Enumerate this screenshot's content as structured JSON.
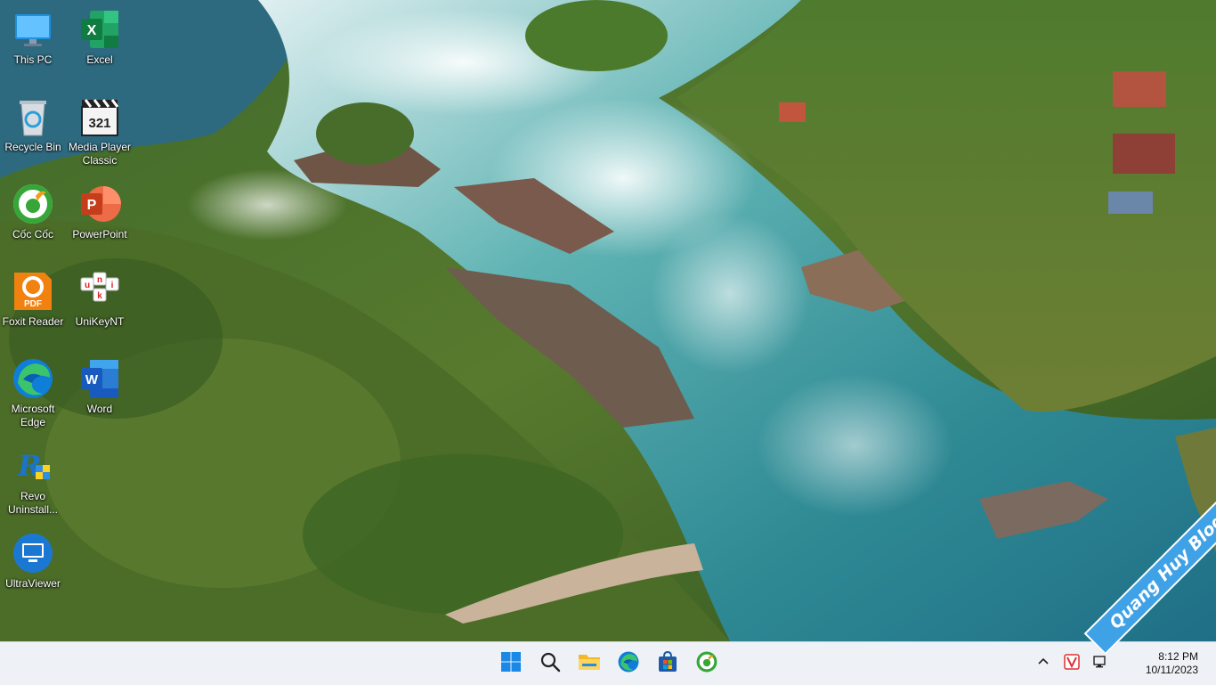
{
  "desktop": {
    "icons": [
      {
        "label": "This PC",
        "icon": "monitor-icon"
      },
      {
        "label": "Excel",
        "icon": "excel-icon"
      },
      {
        "label": "Recycle Bin",
        "icon": "recycle-bin-icon"
      },
      {
        "label": "Media Player Classic",
        "icon": "media-player-icon"
      },
      {
        "label": "Cốc Cốc",
        "icon": "coccoc-icon"
      },
      {
        "label": "PowerPoint",
        "icon": "powerpoint-icon"
      },
      {
        "label": "Foxit Reader",
        "icon": "foxit-pdf-icon"
      },
      {
        "label": "UniKeyNT",
        "icon": "unikey-icon"
      },
      {
        "label": "Microsoft Edge",
        "icon": "edge-icon"
      },
      {
        "label": "Word",
        "icon": "word-icon"
      },
      {
        "label": "Revo Uninstall...",
        "icon": "revo-uninstaller-icon"
      },
      {
        "label": "UltraViewer",
        "icon": "ultraviewer-icon"
      }
    ]
  },
  "taskbar": {
    "pinned": [
      {
        "name": "start",
        "icon": "windows-start-icon"
      },
      {
        "name": "search",
        "icon": "search-icon"
      },
      {
        "name": "file-explorer",
        "icon": "folder-icon"
      },
      {
        "name": "edge",
        "icon": "edge-icon"
      },
      {
        "name": "store",
        "icon": "store-icon"
      },
      {
        "name": "coccoc",
        "icon": "coccoc-icon"
      }
    ],
    "tray": {
      "overflow_icon": "chevron-up-icon",
      "vivaldi_icon": "vivaldi-icon",
      "network_icon": "network-icon"
    },
    "clock": {
      "time": "8:12 PM",
      "date": "10/11/2023"
    }
  },
  "watermark": "Quang Huy Blog",
  "colors": {
    "taskbar_bg": "#eef1f6",
    "watermark_bg": "#3fa1e6"
  }
}
